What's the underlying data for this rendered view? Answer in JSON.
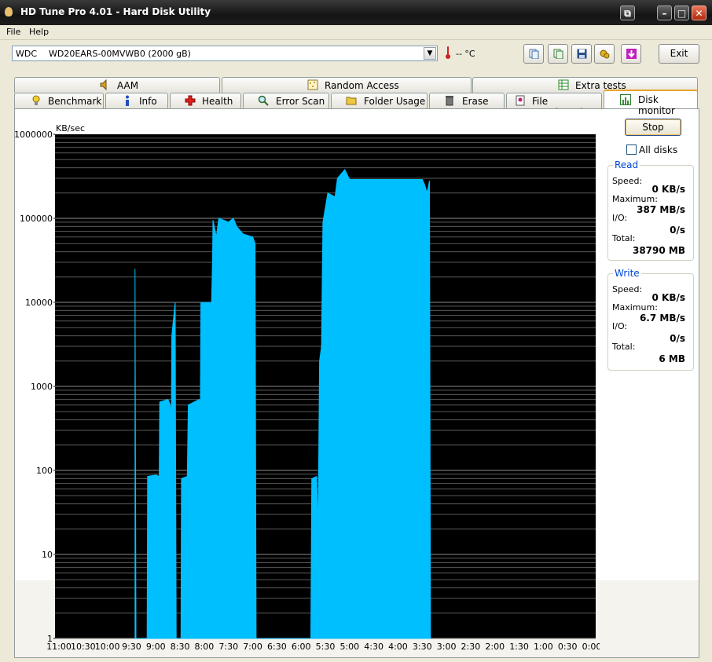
{
  "window": {
    "title": "HD Tune Pro 4.01 - Hard Disk Utility"
  },
  "menu": {
    "file": "File",
    "help": "Help"
  },
  "drive": {
    "vendor": "WDC",
    "model": "WD20EARS-00MVWB0 (2000 gB)"
  },
  "temperature": "-- °C",
  "toolbar": {
    "icons": [
      "copy-text-icon",
      "copy-screenshot-icon",
      "save-icon",
      "options-icon",
      "download-icon"
    ],
    "exit_label": "Exit"
  },
  "tabs_top": [
    {
      "label": "AAM",
      "icon": "speaker-icon"
    },
    {
      "label": "Random Access",
      "icon": "random-grid-icon"
    },
    {
      "label": "Extra tests",
      "icon": "table-icon"
    }
  ],
  "tabs_bottom": [
    {
      "label": "Benchmark",
      "icon": "bulb-icon"
    },
    {
      "label": "Info",
      "icon": "info-icon"
    },
    {
      "label": "Health",
      "icon": "red-cross-icon"
    },
    {
      "label": "Error Scan",
      "icon": "magnifier-icon"
    },
    {
      "label": "Folder Usage",
      "icon": "folder-icon"
    },
    {
      "label": "Erase",
      "icon": "trash-icon"
    },
    {
      "label": "File Benchmark",
      "icon": "file-benchmark-icon"
    },
    {
      "label": "Disk monitor",
      "icon": "monitor-chart-icon",
      "active": true
    }
  ],
  "controls": {
    "stop_label": "Stop",
    "all_disks_label": "All disks",
    "all_disks_checked": false
  },
  "read": {
    "title": "Read",
    "speed_label": "Speed:",
    "speed": "0 KB/s",
    "max_label": "Maximum:",
    "max": "387 MB/s",
    "io_label": "I/O:",
    "io": "0/s",
    "total_label": "Total:",
    "total": "38790 MB"
  },
  "write": {
    "title": "Write",
    "speed_label": "Speed:",
    "speed": "0 KB/s",
    "max_label": "Maximum:",
    "max": "6.7 MB/s",
    "io_label": "I/O:",
    "io": "0/s",
    "total_label": "Total:",
    "total": "6 MB"
  },
  "colors": {
    "trace": "#00bfff",
    "plot_bg": "#000000",
    "grid": "#5a5a5a",
    "accent": "#0046d5"
  },
  "chart_data": {
    "type": "area",
    "ylabel": "KB/sec",
    "yscale": "log",
    "ylim": [
      1,
      1000000
    ],
    "y_ticks": [
      "1000000",
      "100000",
      "10000",
      "1000",
      "100",
      "10",
      "1"
    ],
    "x_ticks": [
      "11:00",
      "10:30",
      "10:00",
      "9:30",
      "9:00",
      "8:30",
      "8:00",
      "7:30",
      "7:00",
      "6:30",
      "6:00",
      "5:30",
      "5:00",
      "4:30",
      "4:00",
      "3:30",
      "3:00",
      "2:30",
      "2:00",
      "1:30",
      "1:00",
      "0:30",
      "0:00"
    ],
    "x_unit_note": "minutes:seconds before now",
    "series": [
      {
        "points": [
          [
            9.43,
            25000
          ],
          [
            9.41,
            1
          ],
          [
            9.18,
            1
          ],
          [
            9.17,
            85
          ],
          [
            9.0,
            88
          ],
          [
            8.93,
            85
          ],
          [
            8.92,
            650
          ],
          [
            8.75,
            700
          ],
          [
            8.7,
            600
          ],
          [
            8.68,
            350
          ],
          [
            8.67,
            4000
          ],
          [
            8.6,
            10000
          ],
          [
            8.58,
            1
          ],
          [
            8.48,
            1
          ],
          [
            8.47,
            80
          ],
          [
            8.35,
            85
          ],
          [
            8.33,
            600
          ],
          [
            8.1,
            700
          ],
          [
            8.08,
            600
          ],
          [
            8.07,
            10000
          ],
          [
            7.85,
            10000
          ],
          [
            7.83,
            30000
          ],
          [
            7.82,
            95000
          ],
          [
            7.75,
            60000
          ],
          [
            7.7,
            100000
          ],
          [
            7.5,
            90000
          ],
          [
            7.4,
            100000
          ],
          [
            7.33,
            80000
          ],
          [
            7.2,
            65000
          ],
          [
            7.0,
            60000
          ],
          [
            6.95,
            50000
          ],
          [
            6.93,
            1
          ],
          [
            5.8,
            1
          ],
          [
            5.78,
            80
          ],
          [
            5.68,
            85
          ],
          [
            5.65,
            20
          ],
          [
            5.62,
            2000
          ],
          [
            5.58,
            3000
          ],
          [
            5.55,
            90000
          ],
          [
            5.45,
            200000
          ],
          [
            5.3,
            180000
          ],
          [
            5.25,
            300000
          ],
          [
            5.1,
            380000
          ],
          [
            5.0,
            290000
          ],
          [
            4.5,
            290000
          ],
          [
            4.0,
            290000
          ],
          [
            3.5,
            290000
          ],
          [
            3.45,
            250000
          ],
          [
            3.4,
            200000
          ],
          [
            3.35,
            280000
          ],
          [
            3.33,
            1
          ]
        ]
      }
    ]
  }
}
